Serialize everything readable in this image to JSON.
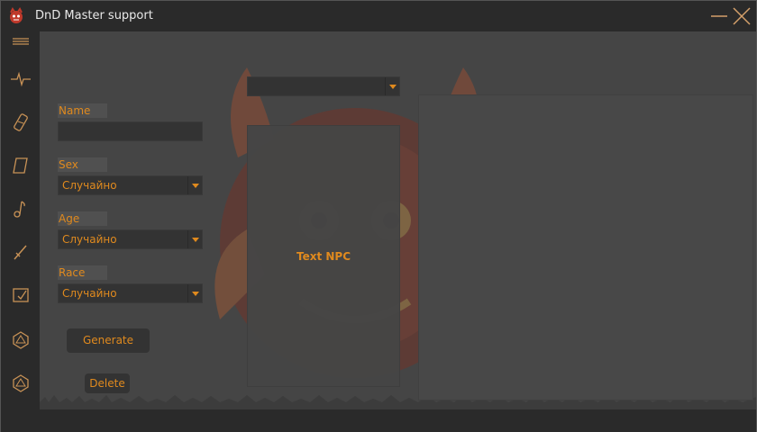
{
  "window": {
    "title": "DnD Master support"
  },
  "sidebar": {
    "items": [
      {
        "icon": "menu-icon"
      },
      {
        "icon": "pulse-icon"
      },
      {
        "icon": "bandage-icon"
      },
      {
        "icon": "scroll-icon"
      },
      {
        "icon": "music-note-icon"
      },
      {
        "icon": "dagger-icon"
      },
      {
        "icon": "checklist-icon"
      },
      {
        "icon": "d20-icon"
      },
      {
        "icon": "d20-alt-icon"
      }
    ]
  },
  "form": {
    "name_label": "Name",
    "name_value": "",
    "sex_label": "Sex",
    "sex_value": "Случайно",
    "age_label": "Age",
    "age_value": "Случайно",
    "race_label": "Race",
    "race_value": "Случайно",
    "generate_label": "Generate",
    "delete_label": "Delete"
  },
  "top_select": {
    "value": ""
  },
  "npc_panel": {
    "text": "Text NPC"
  },
  "colors": {
    "accent": "#e08a1e",
    "background": "#2a2a2a",
    "panel": "#454545"
  }
}
